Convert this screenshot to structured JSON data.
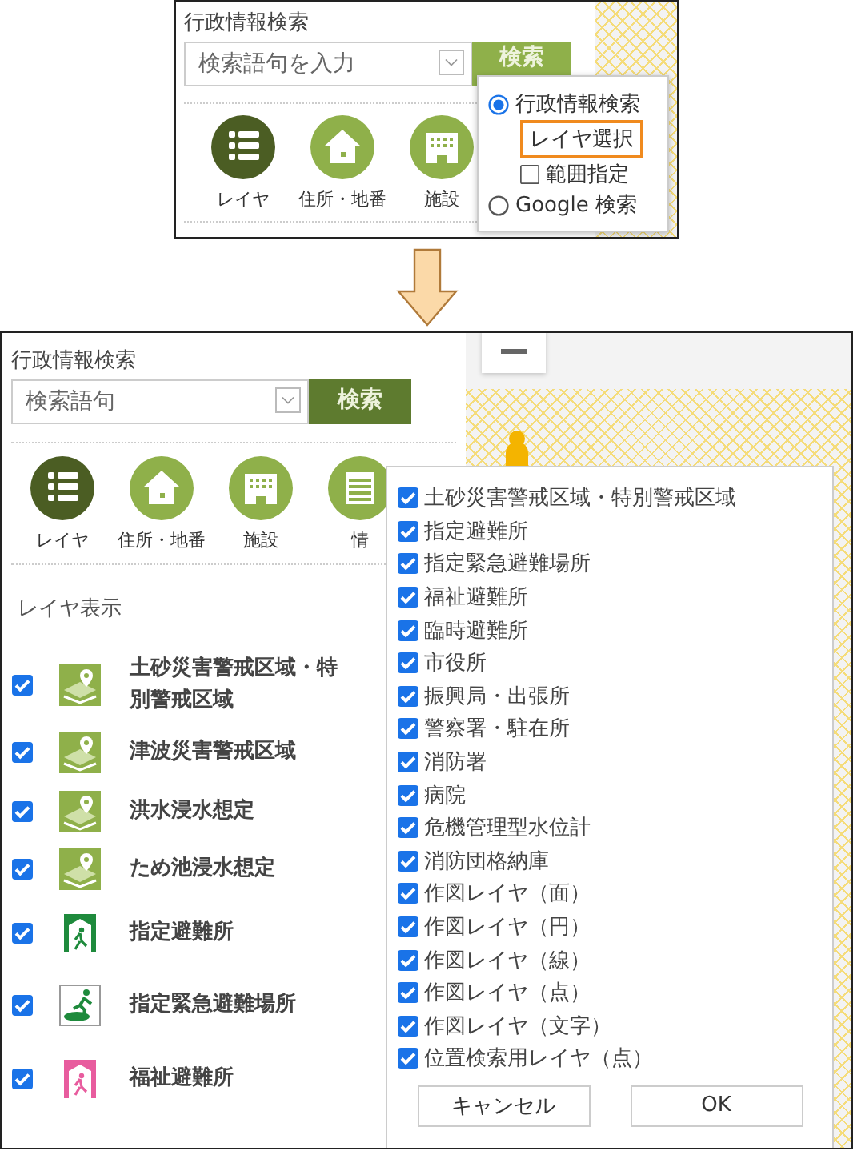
{
  "before": {
    "title": "行政情報検索",
    "search": {
      "placeholder": "検索語句を入力"
    },
    "search_button": "検索",
    "categories": [
      {
        "label": "レイヤ",
        "kind": "list",
        "selected": true
      },
      {
        "label": "住所・地番",
        "kind": "house",
        "selected": false
      },
      {
        "label": "施設",
        "kind": "building",
        "selected": false
      }
    ],
    "mode_menu": {
      "options": [
        {
          "label": "行政情報検索",
          "kind": "radio",
          "selected": true
        },
        {
          "label": "レイヤ選択",
          "kind": "button",
          "highlighted": true
        },
        {
          "label": "範囲指定",
          "kind": "checkbox",
          "checked": false
        },
        {
          "label": "Google 検索",
          "kind": "radio",
          "selected": false
        }
      ]
    }
  },
  "after": {
    "title": "行政情報検索",
    "search": {
      "placeholder": "検索語句"
    },
    "search_button": "検索",
    "categories": [
      {
        "label": "レイヤ",
        "kind": "list",
        "selected": true
      },
      {
        "label": "住所・地番",
        "kind": "house",
        "selected": false
      },
      {
        "label": "施設",
        "kind": "building",
        "selected": false
      },
      {
        "label": "情",
        "kind": "document",
        "selected": false
      }
    ],
    "layer_display": {
      "heading": "レイヤ表示",
      "layers": [
        {
          "label": "土砂災害警戒区域・特別警戒区域",
          "kind": "hazard",
          "checked": true
        },
        {
          "label": "津波災害警戒区域",
          "kind": "hazard",
          "checked": true
        },
        {
          "label": "洪水浸水想定",
          "kind": "hazard",
          "checked": true
        },
        {
          "label": "ため池浸水想定",
          "kind": "hazard",
          "checked": true
        },
        {
          "label": "指定避難所",
          "kind": "shelter",
          "checked": true
        },
        {
          "label": "指定緊急避難場所",
          "kind": "evacuation",
          "checked": true
        },
        {
          "label": "福祉避難所",
          "kind": "welfare",
          "checked": true
        }
      ]
    },
    "layer_popup": {
      "items": [
        {
          "label": "土砂災害警戒区域・特別警戒区域",
          "checked": true
        },
        {
          "label": "指定避難所",
          "checked": true
        },
        {
          "label": "指定緊急避難場所",
          "checked": true
        },
        {
          "label": "福祉避難所",
          "checked": true
        },
        {
          "label": "臨時避難所",
          "checked": true
        },
        {
          "label": "市役所",
          "checked": true
        },
        {
          "label": "振興局・出張所",
          "checked": true
        },
        {
          "label": "警察署・駐在所",
          "checked": true
        },
        {
          "label": "消防署",
          "checked": true
        },
        {
          "label": "病院",
          "checked": true
        },
        {
          "label": "危機管理型水位計",
          "checked": true
        },
        {
          "label": "消防団格納庫",
          "checked": true
        },
        {
          "label": "作図レイヤ（面）",
          "checked": true
        },
        {
          "label": "作図レイヤ（円）",
          "checked": true
        },
        {
          "label": "作図レイヤ（線）",
          "checked": true
        },
        {
          "label": "作図レイヤ（点）",
          "checked": true
        },
        {
          "label": "作図レイヤ（文字）",
          "checked": true
        },
        {
          "label": "位置検索用レイヤ（点）",
          "checked": true
        }
      ],
      "buttons": [
        "キャンセル",
        "OK"
      ]
    }
  }
}
